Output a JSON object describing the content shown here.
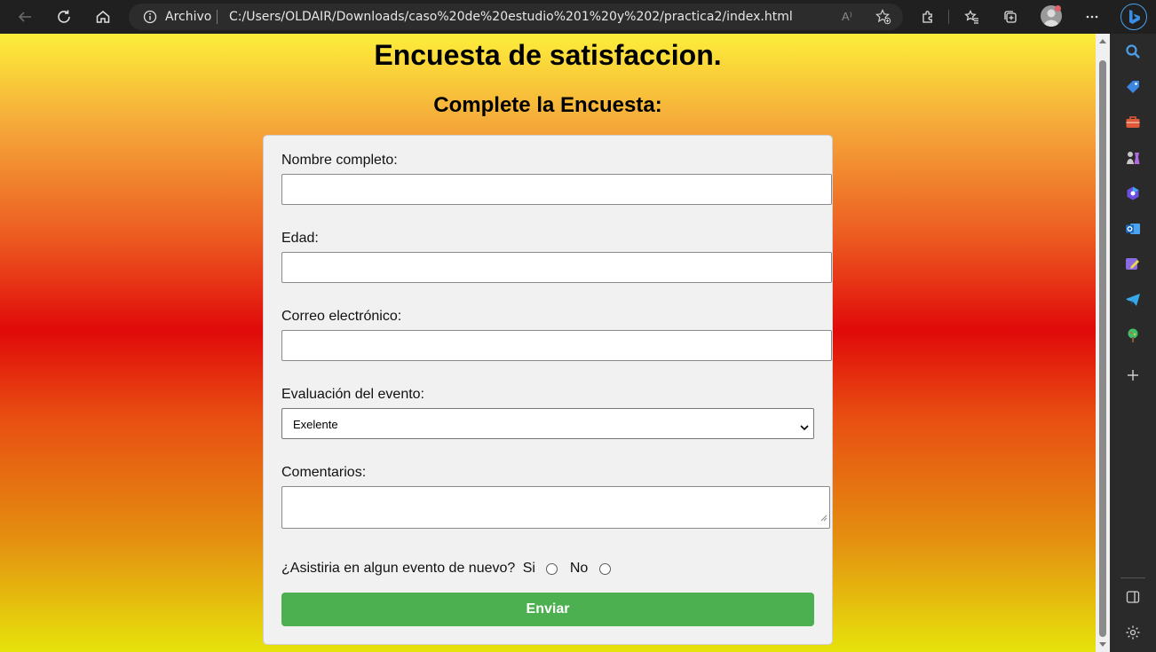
{
  "browser": {
    "site_label": "Archivo",
    "url": "C:/Users/OLDAIR/Downloads/caso%20de%20estudio%201%20y%202/practica2/index.html",
    "read_aloud_label": "A⁾",
    "icons": [
      "back-icon",
      "refresh-icon",
      "home-icon",
      "info-icon",
      "read-aloud-icon",
      "add-favorite-icon",
      "extensions-icon",
      "favorites-icon",
      "collections-icon",
      "profile-avatar",
      "more-icon",
      "bing-chat-icon"
    ]
  },
  "sidebar": {
    "items": [
      "search-icon",
      "shopping-tag-icon",
      "tools-briefcase-icon",
      "games-icon",
      "copilot-icon",
      "outlook-icon",
      "designer-icon",
      "telegram-icon",
      "tree-icon",
      "add-icon",
      "split-screen-icon",
      "settings-icon"
    ],
    "colors": {
      "search": "#4d9ee8",
      "tag": "#3b86e0",
      "briefcase": "#e05a3a",
      "chess": "#b46ae0",
      "outlook": "#2b7cd3",
      "tree": "#3fbf6a"
    }
  },
  "page": {
    "title": "Encuesta de satisfaccion.",
    "subtitle": "Complete la Encuesta:",
    "form": {
      "name_label": "Nombre completo:",
      "name_value": "",
      "age_label": "Edad:",
      "age_value": "",
      "email_label": "Correo electrónico:",
      "email_value": "",
      "rating_label": "Evaluación del evento:",
      "rating_selected": "Exelente",
      "comments_label": "Comentarios:",
      "comments_value": "",
      "attend_question": "¿Asistiria en algun evento de nuevo?",
      "option_yes": "Si",
      "option_no": "No",
      "submit_label": "Enviar"
    },
    "colors": {
      "submit_bg": "#4caf50",
      "form_bg": "#f1f1f1"
    }
  }
}
